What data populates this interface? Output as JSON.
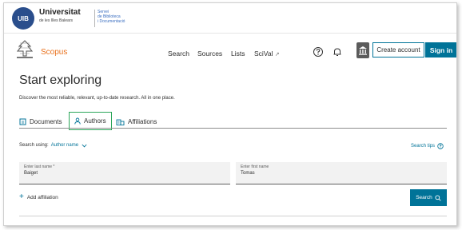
{
  "university": {
    "logo_text": "UIB",
    "name": "Universitat",
    "subname": "de les Illes Balears",
    "service_lines": [
      "Servei",
      "de Biblioteca",
      "i Documentació"
    ]
  },
  "nav": {
    "brand": "Scopus",
    "links": [
      "Search",
      "Sources",
      "Lists",
      "SciVal"
    ],
    "scival_arrow": "↗",
    "create_account": "Create account",
    "sign_in": "Sign in"
  },
  "main": {
    "title": "Start exploring",
    "subtitle": "Discover the most reliable, relevant, up-to-date research. All in one place.",
    "tabs": [
      {
        "label": "Documents",
        "icon": "document-icon",
        "active": false
      },
      {
        "label": "Authors",
        "icon": "person-icon",
        "active": true
      },
      {
        "label": "Affiliations",
        "icon": "building-icon",
        "active": false
      }
    ],
    "search_using_label": "Search using:",
    "search_using_value": "Author name",
    "search_tips": "Search tips",
    "last_name_label": "Enter last name *",
    "last_name_value": "Baiget",
    "first_name_label": "Enter first name",
    "first_name_value": "Tomas",
    "add_affiliation": "Add affiliation",
    "search_button": "Search"
  },
  "colors": {
    "accent": "#007398",
    "brand_orange": "#e9711c",
    "active_tab_outline": "#2ca65a"
  }
}
